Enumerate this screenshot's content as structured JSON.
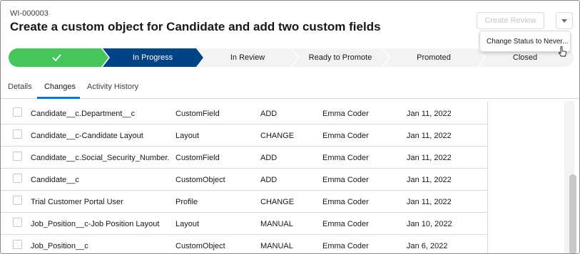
{
  "record": {
    "id": "WI-000003",
    "title": "Create a custom object for Candidate and add two custom fields"
  },
  "header_actions": {
    "create_review": "Create Review",
    "menu_icon": "chevron-down-icon"
  },
  "dropdown": {
    "item": "Change Status to Never..."
  },
  "path": {
    "complete_icon": "checkmark-icon",
    "stages": [
      "In Progress",
      "In Review",
      "Ready to Promote",
      "Promoted",
      "Closed"
    ],
    "current": "In Progress",
    "colors": {
      "complete": "#45c65a",
      "current": "#014486",
      "incomplete": "#f3f3f3"
    }
  },
  "tabs": [
    "Details",
    "Changes",
    "Activity History"
  ],
  "active_tab": "Changes",
  "changes": [
    {
      "name": "Candidate__c.Department__c",
      "type": "CustomField",
      "action": "ADD",
      "user": "Emma Coder",
      "date": "Jan 11, 2022"
    },
    {
      "name": "Candidate__c-Candidate Layout",
      "type": "Layout",
      "action": "CHANGE",
      "user": "Emma Coder",
      "date": "Jan 11, 2022"
    },
    {
      "name": "Candidate__c.Social_Security_Number...",
      "type": "CustomField",
      "action": "ADD",
      "user": "Emma Coder",
      "date": "Jan 11, 2022"
    },
    {
      "name": "Candidate__c",
      "type": "CustomObject",
      "action": "ADD",
      "user": "Emma Coder",
      "date": "Jan 11, 2022"
    },
    {
      "name": "Trial Customer Portal User",
      "type": "Profile",
      "action": "CHANGE",
      "user": "Emma Coder",
      "date": "Jan 11, 2022"
    },
    {
      "name": "Job_Position__c-Job Position Layout",
      "type": "Layout",
      "action": "MANUAL",
      "user": "Emma Coder",
      "date": "Jan 10, 2022"
    },
    {
      "name": "Job_Position__c",
      "type": "CustomObject",
      "action": "MANUAL",
      "user": "Emma Coder",
      "date": "Jan 6, 2022"
    }
  ]
}
